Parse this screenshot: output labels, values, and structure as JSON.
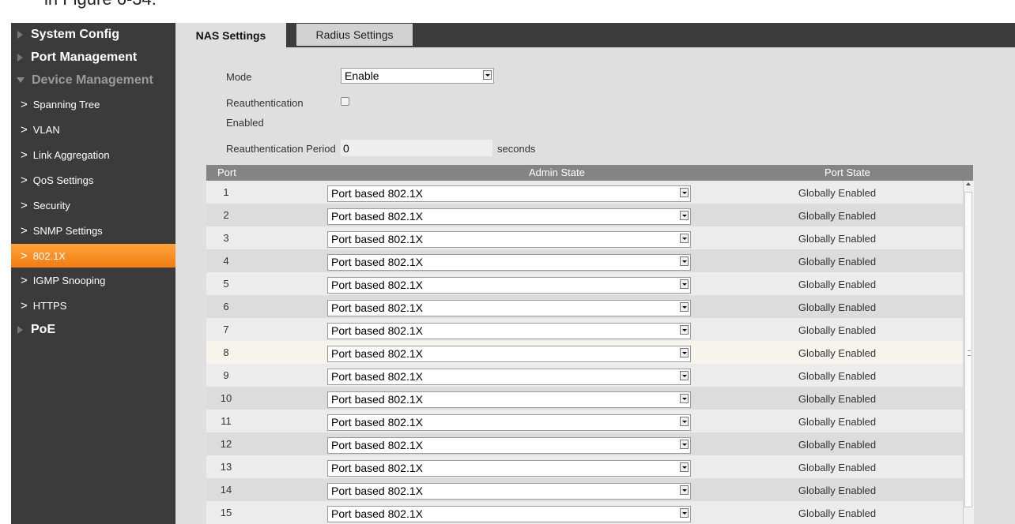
{
  "caption": "in Figure 6-34.",
  "sidebar": {
    "top_items": [
      {
        "label": "System Config"
      },
      {
        "label": "Port Management"
      },
      {
        "label": "Device Management"
      }
    ],
    "sub_items": [
      {
        "label": "Spanning Tree"
      },
      {
        "label": "VLAN"
      },
      {
        "label": "Link Aggregation"
      },
      {
        "label": "QoS Settings"
      },
      {
        "label": "Security"
      },
      {
        "label": "SNMP Settings"
      },
      {
        "label": "802.1X"
      },
      {
        "label": "IGMP Snooping"
      },
      {
        "label": "HTTPS"
      }
    ],
    "bottom_item": {
      "label": "PoE"
    }
  },
  "tabs": {
    "nas": "NAS Settings",
    "radius": "Radius Settings"
  },
  "form": {
    "mode_label": "Mode",
    "mode_value": "Enable",
    "reauth_label_1": "Reauthentication",
    "reauth_label_2": "Enabled",
    "reauth_checked": false,
    "period_label": "Reauthentication Period",
    "period_value": "0",
    "period_unit": "seconds"
  },
  "table": {
    "headers": {
      "port": "Port",
      "admin": "Admin State",
      "state": "Port State"
    },
    "rows": [
      {
        "port": "1",
        "admin": "Port based 802.1X",
        "state": "Globally Enabled"
      },
      {
        "port": "2",
        "admin": "Port based 802.1X",
        "state": "Globally Enabled"
      },
      {
        "port": "3",
        "admin": "Port based 802.1X",
        "state": "Globally Enabled"
      },
      {
        "port": "4",
        "admin": "Port based 802.1X",
        "state": "Globally Enabled"
      },
      {
        "port": "5",
        "admin": "Port based 802.1X",
        "state": "Globally Enabled"
      },
      {
        "port": "6",
        "admin": "Port based 802.1X",
        "state": "Globally Enabled"
      },
      {
        "port": "7",
        "admin": "Port based 802.1X",
        "state": "Globally Enabled"
      },
      {
        "port": "8",
        "admin": "Port based 802.1X",
        "state": "Globally Enabled"
      },
      {
        "port": "9",
        "admin": "Port based 802.1X",
        "state": "Globally Enabled"
      },
      {
        "port": "10",
        "admin": "Port based 802.1X",
        "state": "Globally Enabled"
      },
      {
        "port": "11",
        "admin": "Port based 802.1X",
        "state": "Globally Enabled"
      },
      {
        "port": "12",
        "admin": "Port based 802.1X",
        "state": "Globally Enabled"
      },
      {
        "port": "13",
        "admin": "Port based 802.1X",
        "state": "Globally Enabled"
      },
      {
        "port": "14",
        "admin": "Port based 802.1X",
        "state": "Globally Enabled"
      },
      {
        "port": "15",
        "admin": "Port based 802.1X",
        "state": "Globally Enabled"
      }
    ]
  },
  "colors": {
    "accent": "#f58a1f",
    "sidebar_bg": "#3b3b3b",
    "content_bg": "#dfdfdf",
    "header_bg": "#848484"
  }
}
